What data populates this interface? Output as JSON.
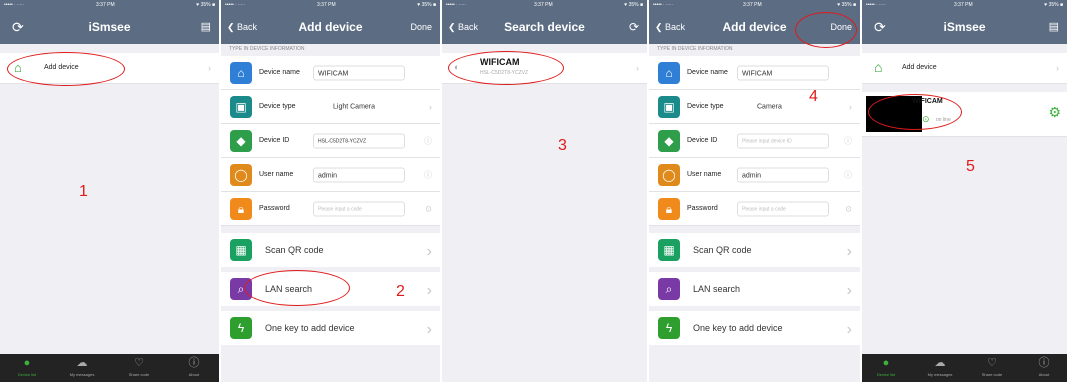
{
  "status": {
    "carrier": "••••• ∙ ∙∙∙∙∙",
    "time": "3:37 PM",
    "battery": "♥ 35% ■"
  },
  "screen1": {
    "title": "iSmsee",
    "add_device_label": "Add device",
    "step": "1",
    "tabs": [
      "Device list",
      "My messages",
      "Share code",
      "About"
    ]
  },
  "screen2": {
    "back": "Back",
    "title": "Add device",
    "done": "Done",
    "section_header": "TYPE IN DEVICE INFORMATION",
    "fields": [
      {
        "label": "Device name",
        "value": "WIFICAM",
        "color": "#2f7fd6",
        "icon": "home-icon"
      },
      {
        "label": "Device type",
        "value": "Light Camera",
        "color": "#1a8a8a",
        "icon": "camera-icon"
      },
      {
        "label": "Device ID",
        "value": "HSL-C5D2T8-YCZVZ",
        "color": "#2e9e4a",
        "icon": "box-icon"
      },
      {
        "label": "User name",
        "value": "admin",
        "color": "#e08a1b",
        "icon": "user-icon"
      },
      {
        "label": "Password",
        "value": "Please input a code",
        "color": "#f08a1b",
        "icon": "lock-icon"
      }
    ],
    "actions": [
      {
        "label": "Scan QR code",
        "color": "#1aa060",
        "icon": "qr-icon"
      },
      {
        "label": "LAN search",
        "color": "#7a3aa6",
        "icon": "search-icon"
      },
      {
        "label": "One key to add device",
        "color": "#2e9e2e",
        "icon": "lightning-icon"
      }
    ],
    "step": "2"
  },
  "screen3": {
    "back": "Back",
    "title": "Search device",
    "device_name": "WIFICAM",
    "device_id": "HSL-C5D2T8-YCZVZ",
    "step": "3"
  },
  "screen4": {
    "back": "Back",
    "title": "Add device",
    "done": "Done",
    "section_header": "TYPE IN DEVICE INFORMATION",
    "fields": [
      {
        "label": "Device name",
        "value": "WIFICAM",
        "color": "#2f7fd6"
      },
      {
        "label": "Device type",
        "value": "Camera",
        "color": "#1a8a8a"
      },
      {
        "label": "Device ID",
        "value": "Please input device ID",
        "color": "#2e9e4a"
      },
      {
        "label": "User name",
        "value": "admin",
        "color": "#e08a1b"
      },
      {
        "label": "Password",
        "value": "Please input a code",
        "color": "#f08a1b"
      }
    ],
    "actions": [
      {
        "label": "Scan QR code",
        "color": "#1aa060"
      },
      {
        "label": "LAN search",
        "color": "#7a3aa6"
      },
      {
        "label": "One key to add device",
        "color": "#2e9e2e"
      }
    ],
    "step": "4"
  },
  "screen5": {
    "title": "iSmsee",
    "add_device_label": "Add device",
    "device_name": "WIFICAM",
    "device_status": "on line",
    "step": "5",
    "tabs": [
      "Device list",
      "My messages",
      "Share code",
      "About"
    ]
  }
}
